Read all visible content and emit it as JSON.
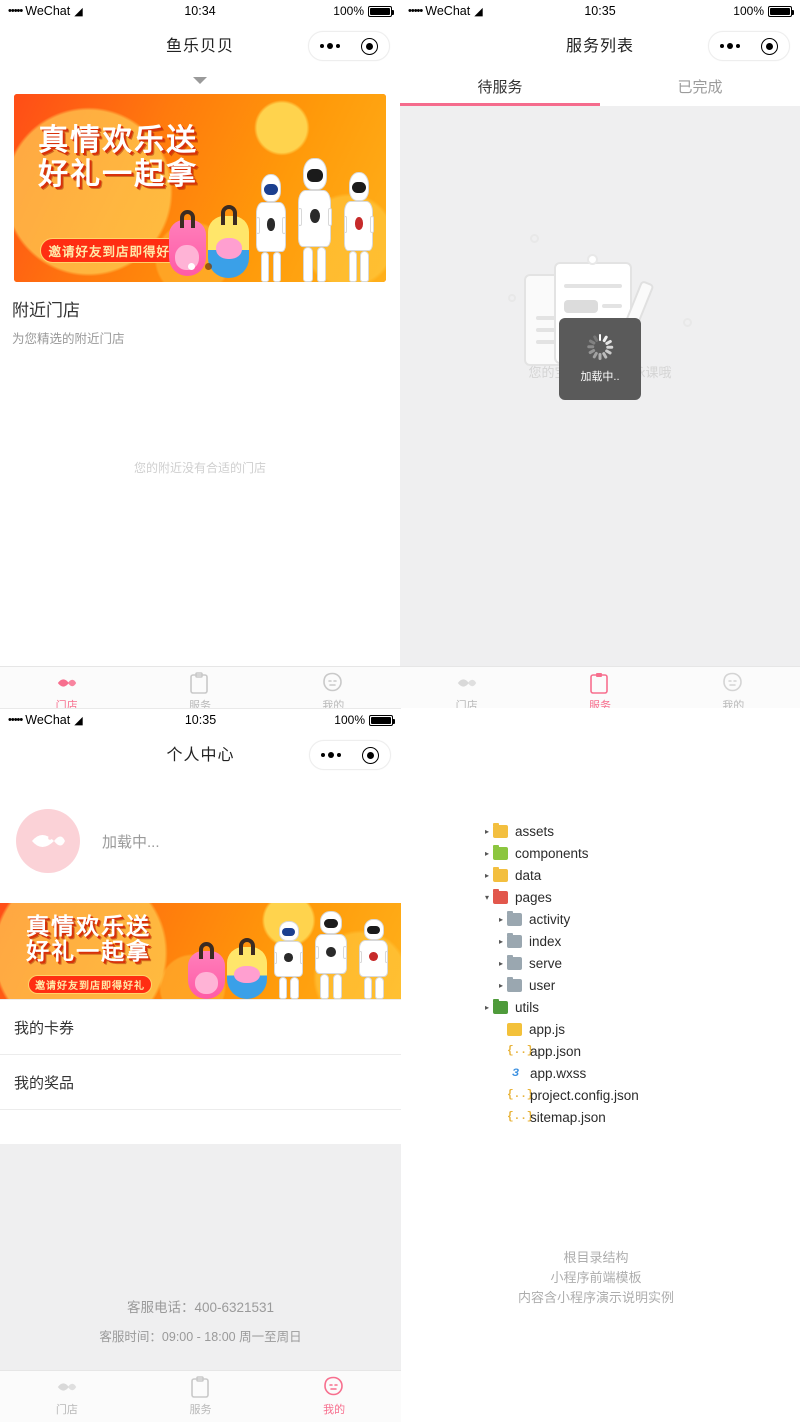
{
  "statusbar": {
    "carrier": "WeChat",
    "dots": "•••••",
    "battery": "100%",
    "time_store": "10:34",
    "time_service": "10:35",
    "time_profile": "10:35"
  },
  "colors": {
    "accent_pink": "#f76f8e",
    "tab_underline": "#f56c8d",
    "banner_orange": "#ff6a10",
    "gray_bg": "#efeff0"
  },
  "store_page": {
    "nav_title": "鱼乐贝贝",
    "banner": {
      "line1": "真情欢乐送",
      "line2": "好礼一起拿",
      "cta": "邀请好友到店即得好礼",
      "dots_count": 2,
      "active_dot": 0
    },
    "section_title": "附近门店",
    "section_sub": "为您精选的附近门店",
    "empty_text": "您的附近没有合适的门店",
    "tabbar": [
      {
        "label": "门店",
        "icon": "fish-icon",
        "active": true
      },
      {
        "label": "服务",
        "icon": "clipboard-icon",
        "active": false
      },
      {
        "label": "我的",
        "icon": "face-icon",
        "active": false
      }
    ]
  },
  "service_page": {
    "nav_title": "服务列表",
    "tabs": [
      {
        "label": "待服务",
        "active": true
      },
      {
        "label": "已完成",
        "active": false
      }
    ],
    "empty_text": "您的宝宝还没有游泳课哦",
    "toast_text": "加载中..",
    "tabbar": [
      {
        "label": "门店",
        "icon": "fish-icon",
        "active": false
      },
      {
        "label": "服务",
        "icon": "clipboard-icon",
        "active": true
      },
      {
        "label": "我的",
        "icon": "face-icon",
        "active": false
      }
    ]
  },
  "profile_page": {
    "nav_title": "个人中心",
    "loading_text": "加载中...",
    "banner": {
      "line1": "真情欢乐送",
      "line2": "好礼一起拿",
      "cta": "邀请好友到店即得好礼"
    },
    "menu": [
      {
        "label": "我的卡券"
      },
      {
        "label": "我的奖品"
      }
    ],
    "footer": {
      "phone": "客服电话：400-6321531",
      "hours": "客服时间：09:00 - 18:00 周一至周日"
    },
    "tabbar": [
      {
        "label": "门店",
        "icon": "fish-icon",
        "active": false
      },
      {
        "label": "服务",
        "icon": "clipboard-icon",
        "active": false
      },
      {
        "label": "我的",
        "icon": "face-icon",
        "active": true
      }
    ]
  },
  "file_tree": {
    "nodes": [
      {
        "label": "assets",
        "type": "folder",
        "color": "yellow",
        "indent": 0,
        "twisty": "▸"
      },
      {
        "label": "components",
        "type": "folder",
        "color": "green",
        "indent": 0,
        "twisty": "▸"
      },
      {
        "label": "data",
        "type": "folder",
        "color": "yellow",
        "indent": 0,
        "twisty": "▸"
      },
      {
        "label": "pages",
        "type": "folder",
        "color": "red",
        "indent": 0,
        "twisty": "▾"
      },
      {
        "label": "activity",
        "type": "folder",
        "color": "gray",
        "indent": 1,
        "twisty": "▸"
      },
      {
        "label": "index",
        "type": "folder",
        "color": "gray",
        "indent": 1,
        "twisty": "▸"
      },
      {
        "label": "serve",
        "type": "folder",
        "color": "gray",
        "indent": 1,
        "twisty": "▸"
      },
      {
        "label": "user",
        "type": "folder",
        "color": "gray",
        "indent": 1,
        "twisty": "▸"
      },
      {
        "label": "utils",
        "type": "folder",
        "color": "greend",
        "indent": 0,
        "twisty": "▸"
      },
      {
        "label": "app.js",
        "type": "js",
        "icon_text": "",
        "indent": 1,
        "twisty": ""
      },
      {
        "label": "app.json",
        "type": "json",
        "icon_text": "{..}",
        "indent": 1,
        "twisty": ""
      },
      {
        "label": "app.wxss",
        "type": "wxss",
        "icon_text": "З",
        "indent": 1,
        "twisty": ""
      },
      {
        "label": "project.config.json",
        "type": "json",
        "icon_text": "{..}",
        "indent": 1,
        "twisty": ""
      },
      {
        "label": "sitemap.json",
        "type": "json",
        "icon_text": "{..}",
        "indent": 1,
        "twisty": ""
      }
    ],
    "watermark": {
      "l1": "根目录结构",
      "l2": "小程序前端模板",
      "l3": "内容含小程序演示说明实例"
    }
  }
}
